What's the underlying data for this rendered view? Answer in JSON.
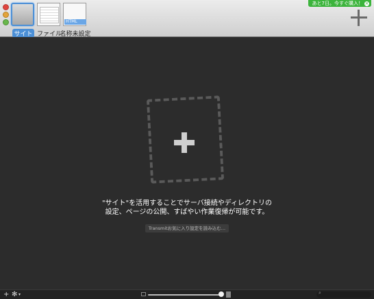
{
  "toolbar": {
    "tabs": [
      {
        "label": "サイト"
      },
      {
        "label": "ファイル"
      },
      {
        "label": "名称未設定",
        "badge": "HTML"
      }
    ],
    "buy_badge": "あと7日。今すぐ購入！",
    "buy_close": "×",
    "fullscreen_icon": "⤢"
  },
  "main": {
    "promo_line1": "\"サイト\"を活用することでサーバ接続やディレクトリの",
    "promo_line2": "設定、ページの公開、すばやい作業復帰が可能です。",
    "import_button": "Transmitお気に入り設定を読み込む…"
  },
  "bottombar": {
    "add_glyph": "+",
    "gear_glyph": "✻",
    "caret_glyph": "▾",
    "search_glyph": "⌕"
  },
  "colors": {
    "accent": "#4b8fd6",
    "buy": "#3cb43c",
    "background": "#2c2c2c"
  }
}
